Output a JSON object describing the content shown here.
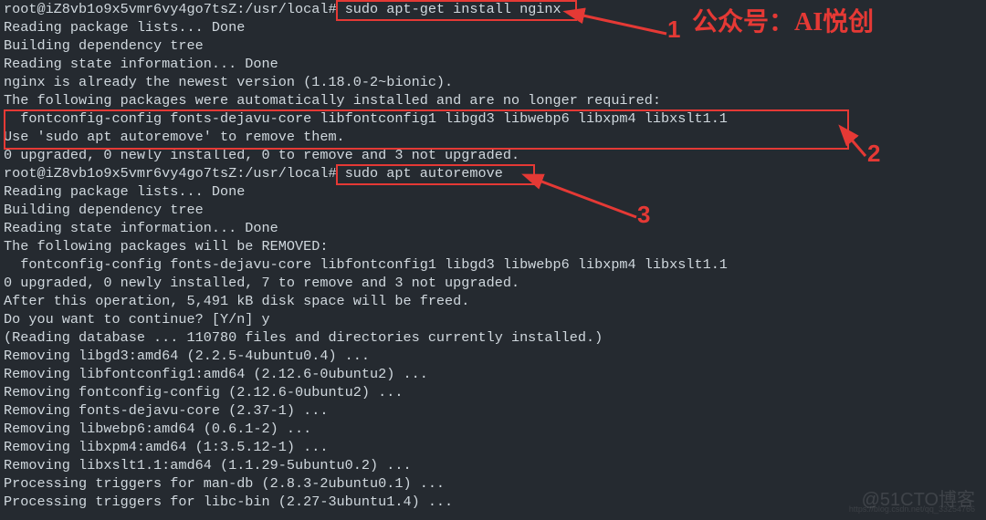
{
  "colors": {
    "bg": "#252a30",
    "fg": "#d0d8de",
    "accent": "#e53935"
  },
  "annotation": {
    "num1": "1",
    "num2": "2",
    "num3": "3",
    "label_top": "公众号：AI悦创"
  },
  "watermark": {
    "main": "@51CTO博客",
    "sub": "https://blog.csdn.net/qq_33254766"
  },
  "term": {
    "lines": [
      {
        "prompt": "root@iZ8vb1o9x5vmr6vy4go7tsZ:/usr/local# ",
        "cmd": "sudo apt-get install nginx"
      },
      {
        "text": "Reading package lists... Done"
      },
      {
        "text": "Building dependency tree"
      },
      {
        "text": "Reading state information... Done"
      },
      {
        "text": "nginx is already the newest version (1.18.0-2~bionic)."
      },
      {
        "text": "The following packages were automatically installed and are no longer required:"
      },
      {
        "text": "  fontconfig-config fonts-dejavu-core libfontconfig1 libgd3 libwebp6 libxpm4 libxslt1.1"
      },
      {
        "text": "Use 'sudo apt autoremove' to remove them."
      },
      {
        "text": "0 upgraded, 0 newly installed, 0 to remove and 3 not upgraded."
      },
      {
        "prompt": "root@iZ8vb1o9x5vmr6vy4go7tsZ:/usr/local# ",
        "cmd": "sudo apt autoremove"
      },
      {
        "text": "Reading package lists... Done"
      },
      {
        "text": "Building dependency tree"
      },
      {
        "text": "Reading state information... Done"
      },
      {
        "text": "The following packages will be REMOVED:"
      },
      {
        "text": "  fontconfig-config fonts-dejavu-core libfontconfig1 libgd3 libwebp6 libxpm4 libxslt1.1"
      },
      {
        "text": "0 upgraded, 0 newly installed, 7 to remove and 3 not upgraded."
      },
      {
        "text": "After this operation, 5,491 kB disk space will be freed."
      },
      {
        "text": "Do you want to continue? [Y/n] y"
      },
      {
        "text": "(Reading database ... 110780 files and directories currently installed.)"
      },
      {
        "text": "Removing libgd3:amd64 (2.2.5-4ubuntu0.4) ..."
      },
      {
        "text": "Removing libfontconfig1:amd64 (2.12.6-0ubuntu2) ..."
      },
      {
        "text": "Removing fontconfig-config (2.12.6-0ubuntu2) ..."
      },
      {
        "text": "Removing fonts-dejavu-core (2.37-1) ..."
      },
      {
        "text": "Removing libwebp6:amd64 (0.6.1-2) ..."
      },
      {
        "text": "Removing libxpm4:amd64 (1:3.5.12-1) ..."
      },
      {
        "text": "Removing libxslt1.1:amd64 (1.1.29-5ubuntu0.2) ..."
      },
      {
        "text": "Processing triggers for man-db (2.8.3-2ubuntu0.1) ..."
      },
      {
        "text": "Processing triggers for libc-bin (2.27-3ubuntu1.4) ..."
      }
    ]
  }
}
